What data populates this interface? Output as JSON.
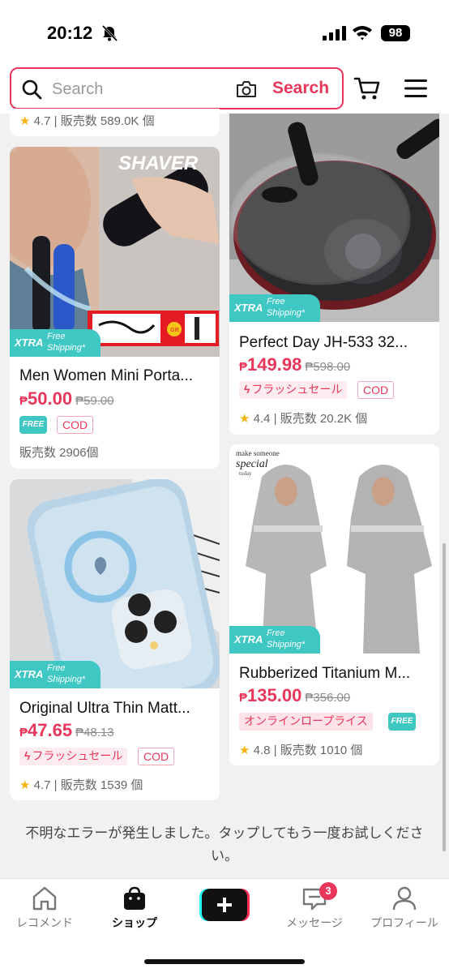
{
  "status_bar": {
    "time": "20:12",
    "battery": "98"
  },
  "search": {
    "placeholder": "Search",
    "button_label": "Search"
  },
  "partial_card": {
    "rating": "4.7",
    "sales": "販売数 589.0K 個"
  },
  "xtra_badge": {
    "xtra": "XTRA",
    "free_shipping_line1": "Free",
    "free_shipping_line2": "Shipping*"
  },
  "products": [
    {
      "title": "Men Women Mini Porta...",
      "price_currency": "₱",
      "price": "50.00",
      "original_price": "₱59.00",
      "image_text": "SHAVER",
      "image_gift_text": "Gift",
      "tags": {
        "free": "FREE",
        "cod": "COD"
      },
      "sales": "販売数 2906個"
    },
    {
      "title": "Perfect Day JH-533 32...",
      "price_currency": "₱",
      "price": "149.98",
      "original_price": "₱598.00",
      "tags": {
        "flash": "フラッシュセール",
        "cod": "COD"
      },
      "rating": "4.4",
      "sales": "販売数 20.2K 個"
    },
    {
      "title": "Original Ultra Thin Matt...",
      "price_currency": "₱",
      "price": "47.65",
      "original_price": "₱48.13",
      "tags": {
        "flash": "フラッシュセール",
        "cod": "COD"
      },
      "rating": "4.7",
      "sales": "販売数 1539 個"
    },
    {
      "title": "Rubberized Titanium M...",
      "price_currency": "₱",
      "price": "135.00",
      "original_price": "₱356.00",
      "image_text_line1": "make someone",
      "image_text_line2": "special",
      "image_text_line3": "today",
      "tags": {
        "low_price": "オンラインロープライス",
        "free": "FREE"
      },
      "rating": "4.8",
      "sales": "販売数 1010 個"
    }
  ],
  "error_message": "不明なエラーが発生しました。タップしてもう一度お試しください。",
  "bottom_nav": {
    "items": [
      {
        "label": "レコメンド",
        "icon": "home-icon"
      },
      {
        "label": "ショップ",
        "icon": "shopping-bag-icon"
      },
      {
        "label": "",
        "icon": "plus-icon"
      },
      {
        "label": "メッセージ",
        "icon": "message-icon",
        "badge": "3"
      },
      {
        "label": "プロフィール",
        "icon": "profile-icon"
      }
    ]
  },
  "colors": {
    "accent": "#e8375a",
    "teal": "#3fc7c4"
  }
}
